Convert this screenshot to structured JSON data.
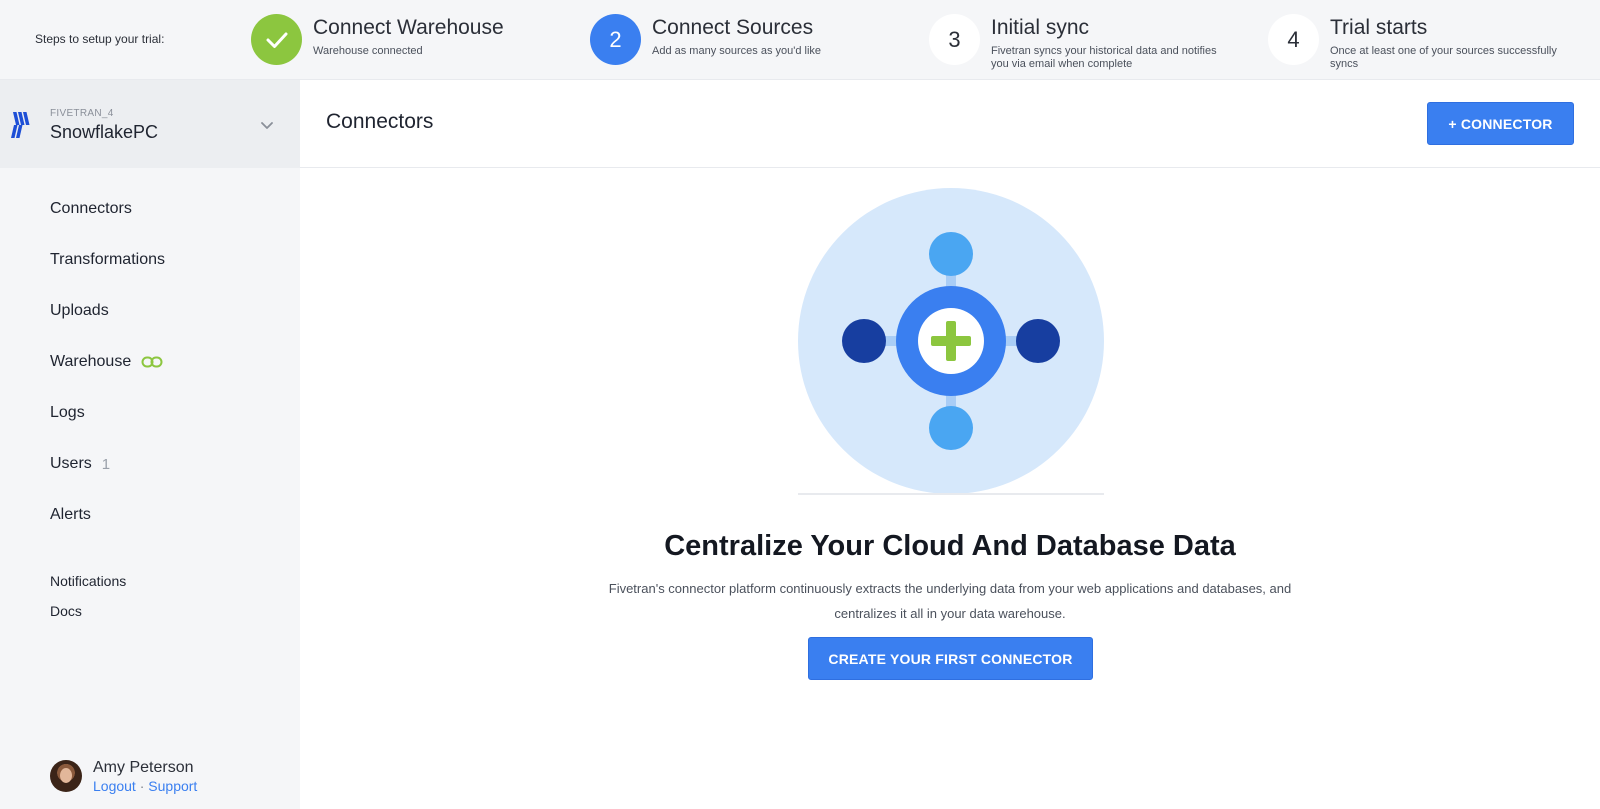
{
  "trial": {
    "intro": "Steps to setup your trial:",
    "steps": [
      {
        "number": "",
        "title": "Connect Warehouse",
        "desc": "Warehouse connected",
        "state": "done"
      },
      {
        "number": "2",
        "title": "Connect Sources",
        "desc": "Add as many sources as you'd like",
        "state": "active"
      },
      {
        "number": "3",
        "title": "Initial sync",
        "desc": "Fivetran syncs your historical data and notifies you via email when complete",
        "state": "pending"
      },
      {
        "number": "4",
        "title": "Trial starts",
        "desc": "Once at least one of your sources successfully syncs",
        "state": "pending"
      }
    ]
  },
  "account": {
    "label": "FIVETRAN_4",
    "name": "SnowflakePC"
  },
  "sidebar": {
    "items": [
      {
        "label": "Connectors"
      },
      {
        "label": "Transformations"
      },
      {
        "label": "Uploads"
      },
      {
        "label": "Warehouse"
      },
      {
        "label": "Logs"
      },
      {
        "label": "Users",
        "count": "1"
      },
      {
        "label": "Alerts"
      }
    ],
    "secondary": [
      {
        "label": "Notifications"
      },
      {
        "label": "Docs"
      }
    ]
  },
  "user": {
    "name": "Amy Peterson",
    "logout": "Logout",
    "separator": "·",
    "support": "Support"
  },
  "main": {
    "title": "Connectors",
    "add_button": "+ CONNECTOR",
    "hero_title": "Centralize Your Cloud And Database Data",
    "hero_desc": "Fivetran's connector platform continuously extracts the underlying data from your web applications and databases, and centralizes it all in your data warehouse.",
    "create_button": "CREATE YOUR FIRST CONNECTOR"
  },
  "colors": {
    "accent": "#3a7ff0",
    "success": "#8cc63f",
    "dark_blue": "#173ea0",
    "light_blue": "#4aa6f2",
    "halo": "#d6e8fb"
  }
}
